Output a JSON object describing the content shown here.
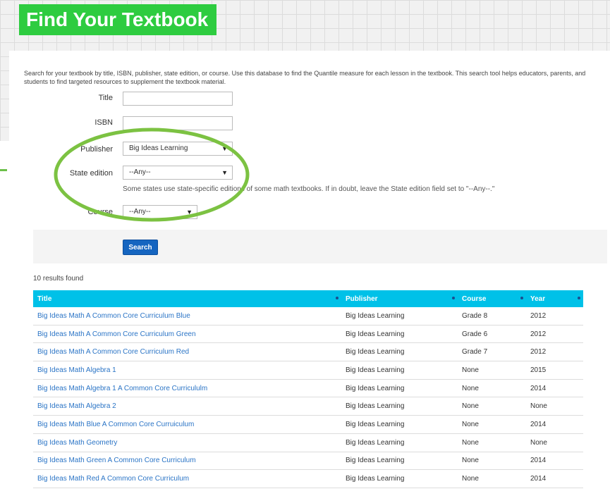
{
  "banner": {
    "title": "Find Your Textbook"
  },
  "intro": "Search for your textbook by title, ISBN, publisher, state edition, or course. Use this database to find the Quantile measure for each lesson in the textbook. This search tool helps educators, parents, and students to find targeted resources to supplement the textbook material.",
  "form": {
    "title_label": "Title",
    "title_value": "",
    "isbn_label": "ISBN",
    "isbn_value": "",
    "publisher_label": "Publisher",
    "publisher_value": "Big Ideas Learning",
    "state_label": "State edition",
    "state_value": "--Any--",
    "state_hint": "Some states use state-specific editions of some math textbooks. If in doubt, leave the State edition field set to \"--Any--.\"",
    "course_label": "Course",
    "course_value": "--Any--",
    "search_label": "Search"
  },
  "results": {
    "count": "10 results found",
    "columns": [
      "Title",
      "Publisher",
      "Course",
      "Year"
    ],
    "rows": [
      [
        "Big Ideas Math A Common Core Curriculum Blue",
        "Big Ideas Learning",
        "Grade 8",
        "2012"
      ],
      [
        "Big Ideas Math A Common Core Curriculum Green",
        "Big Ideas Learning",
        "Grade 6",
        "2012"
      ],
      [
        "Big Ideas Math A Common Core Curriculum Red",
        "Big Ideas Learning",
        "Grade 7",
        "2012"
      ],
      [
        "Big Ideas Math Algebra 1",
        "Big Ideas Learning",
        "None",
        "2015"
      ],
      [
        "Big Ideas Math Algebra 1 A Common Core Curricululm",
        "Big Ideas Learning",
        "None",
        "2014"
      ],
      [
        "Big Ideas Math Algebra 2",
        "Big Ideas Learning",
        "None",
        "None"
      ],
      [
        "Big Ideas Math Blue A Common Core Curruiculum",
        "Big Ideas Learning",
        "None",
        "2014"
      ],
      [
        "Big Ideas Math Geometry",
        "Big Ideas Learning",
        "None",
        "None"
      ],
      [
        "Big Ideas Math Green A Common Core Curriculum",
        "Big Ideas Learning",
        "None",
        "2014"
      ],
      [
        "Big Ideas Math Red A Common Core Curriculum",
        "Big Ideas Learning",
        "None",
        "2014"
      ]
    ]
  },
  "colors": {
    "banner": "#2ecc40",
    "header": "#00c1e8",
    "link": "#2a74c6",
    "button": "#1565c0",
    "highlight": "#7cc242"
  }
}
